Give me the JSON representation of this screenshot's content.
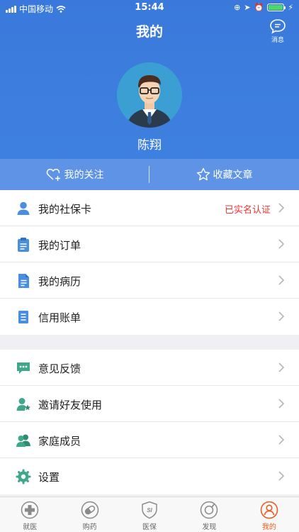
{
  "status": {
    "carrier": "中国移动",
    "time": "15:44"
  },
  "header": {
    "title": "我的",
    "message_label": "消息"
  },
  "profile": {
    "name": "陈翔"
  },
  "follow_bar": {
    "follow_label": "我的关注",
    "collect_label": "收藏文章"
  },
  "group1": [
    {
      "label": "我的社保卡",
      "extra": "已实名认证",
      "icon": "person-icon"
    },
    {
      "label": "我的订单",
      "icon": "clipboard-icon"
    },
    {
      "label": "我的病历",
      "icon": "document-icon"
    },
    {
      "label": "信用账单",
      "icon": "bill-icon"
    }
  ],
  "group2": [
    {
      "label": "意见反馈",
      "icon": "feedback-icon"
    },
    {
      "label": "邀请好友使用",
      "icon": "invite-icon"
    },
    {
      "label": "家庭成员",
      "icon": "family-icon"
    },
    {
      "label": "设置",
      "icon": "gear-icon"
    }
  ],
  "tabs": [
    {
      "label": "就医",
      "icon": "medical-cross-icon"
    },
    {
      "label": "购药",
      "icon": "pill-icon"
    },
    {
      "label": "医保",
      "icon": "si-shield-icon",
      "badge": "SI"
    },
    {
      "label": "发现",
      "icon": "compass-icon"
    },
    {
      "label": "我的",
      "icon": "profile-icon"
    }
  ],
  "colors": {
    "header_blue": "#3a79db",
    "follow_bar": "#5e93e5",
    "icon_blue": "#4a8ee0",
    "icon_green": "#3fa88a",
    "accent_red": "#e33333",
    "tab_active": "#ef5a1f"
  }
}
